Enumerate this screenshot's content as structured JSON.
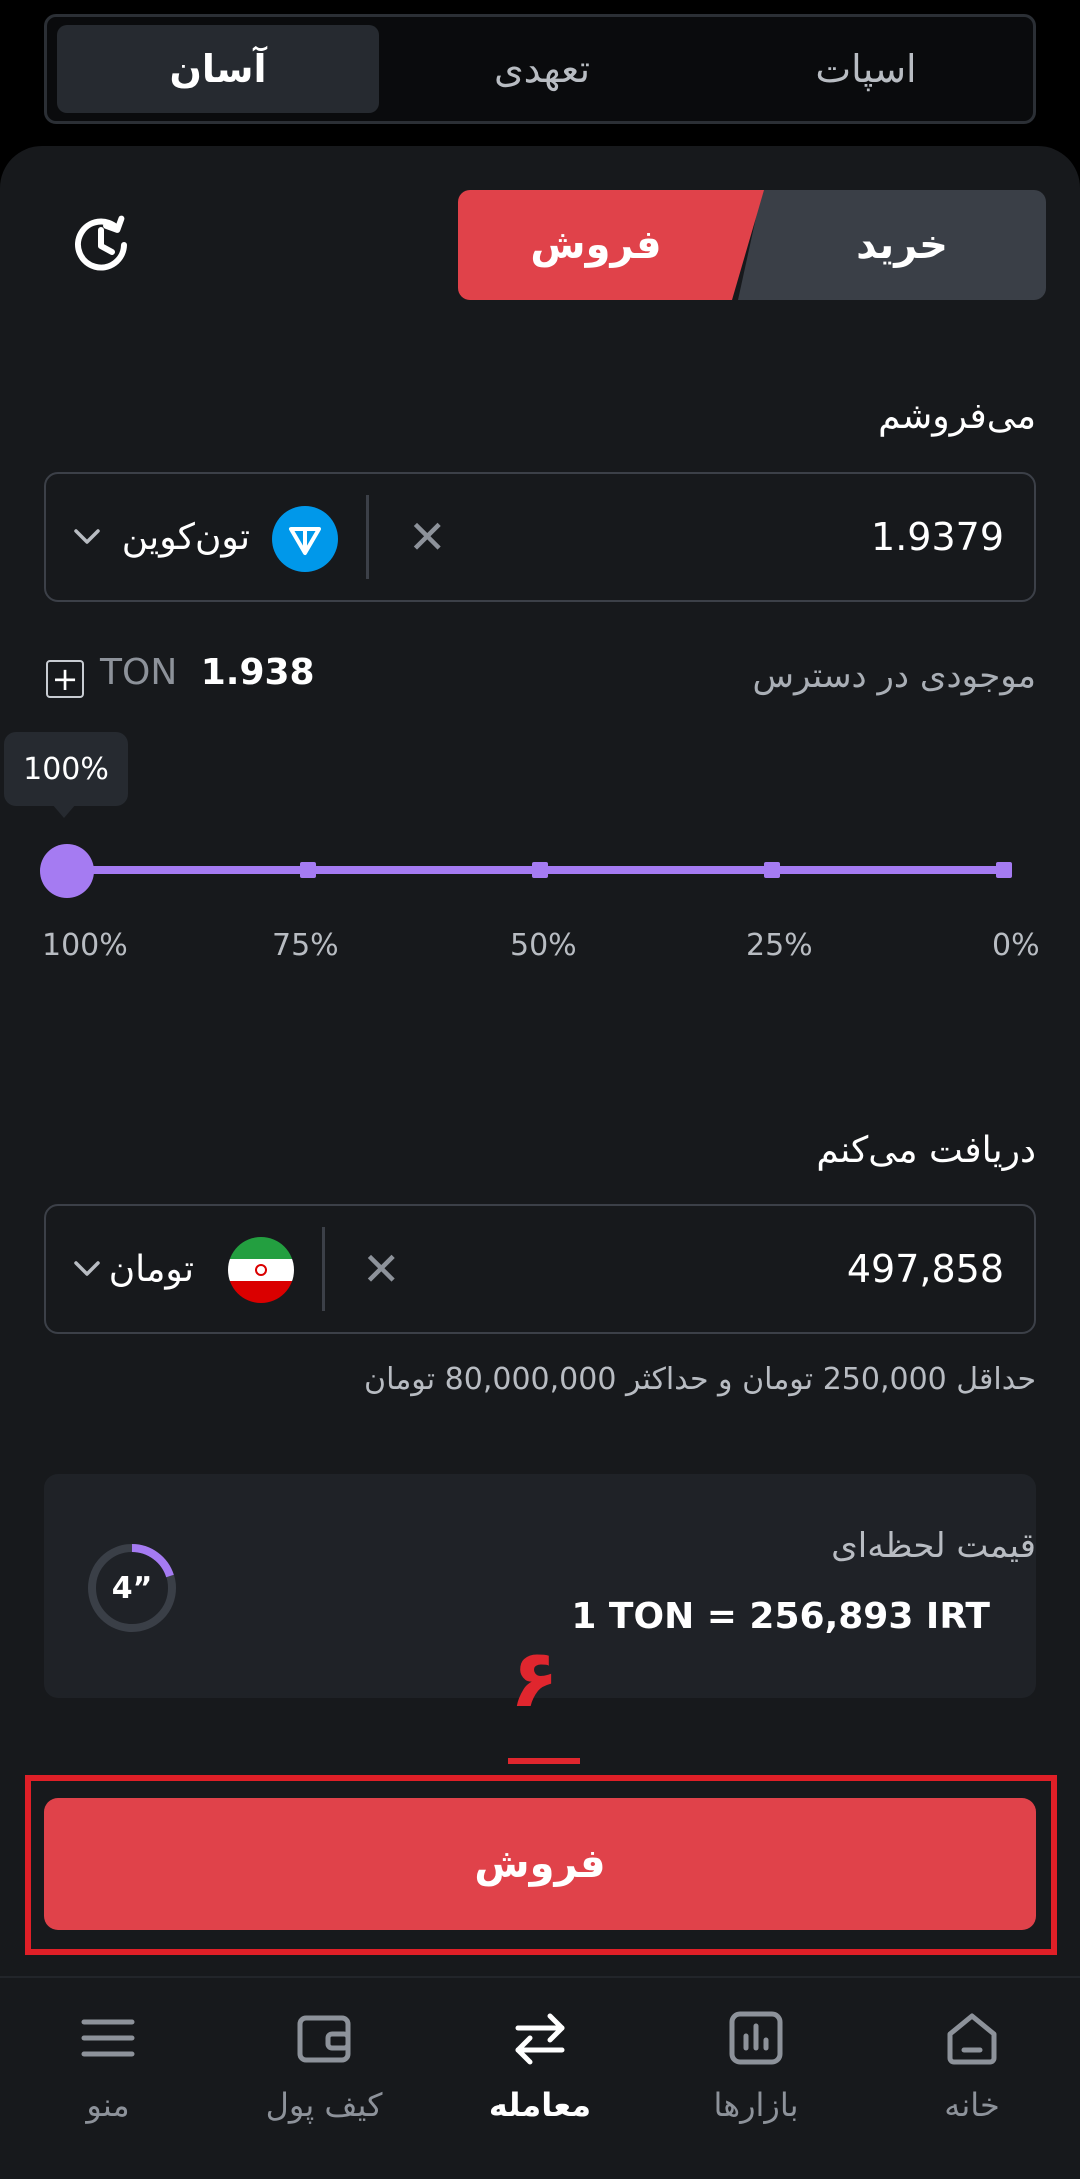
{
  "mode_tabs": [
    {
      "label": "آسان",
      "active": true
    },
    {
      "label": "تعهدی",
      "active": false
    },
    {
      "label": "اسپات",
      "active": false
    }
  ],
  "trade_toggle": {
    "buy_label": "خرید",
    "sell_label": "فروش",
    "selected": "sell"
  },
  "sell_section": {
    "label": "می‌فروشم",
    "value": "1.9379",
    "asset_name": "تون‌کوین",
    "asset_icon": "ton-coin-icon"
  },
  "available": {
    "label": "موجودی در دسترس",
    "amount": "1.938",
    "unit": "TON"
  },
  "slider": {
    "tooltip": "100%",
    "level_percent": 100,
    "labels": [
      "100%",
      "75%",
      "50%",
      "25%",
      "0%"
    ]
  },
  "receive_section": {
    "label": "دریافت می‌کنم",
    "value": "497,858",
    "asset_name": "تومان",
    "asset_icon": "iran-flag-icon"
  },
  "limits_text": "حداقل 250,000 تومان و حداکثر 80,000,000 تومان",
  "price_card": {
    "title": "قیمت لحظه‌ای",
    "value": "1 TON = 256,893 IRT",
    "timer": "4”"
  },
  "annotation": {
    "number": "۶"
  },
  "cta": {
    "label": "فروش"
  },
  "bottom_nav": [
    {
      "label": "منو",
      "icon": "menu-icon"
    },
    {
      "label": "کیف پول",
      "icon": "wallet-icon"
    },
    {
      "label": "معامله",
      "icon": "swap-icon",
      "active": true
    },
    {
      "label": "بازارها",
      "icon": "chart-icon"
    },
    {
      "label": "خانه",
      "icon": "home-icon"
    }
  ],
  "colors": {
    "accent_red": "#e0424a",
    "slider_purple": "#a57bf2",
    "ton_blue": "#0098ea"
  }
}
